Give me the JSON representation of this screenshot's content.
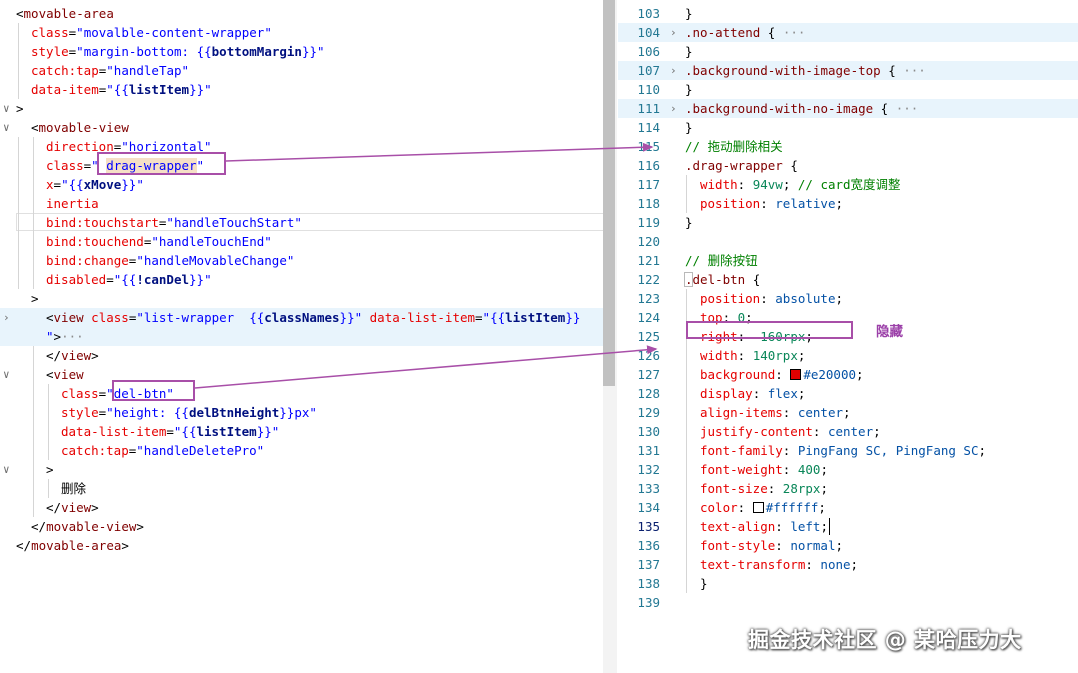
{
  "left_editor": {
    "lines": [
      [
        [
          "c-pun",
          "<"
        ],
        [
          "c-tag",
          "movable-area"
        ]
      ],
      [
        [
          "c-attr",
          "class"
        ],
        [
          "c-pun",
          "="
        ],
        [
          "c-str",
          "\"movalble-content-wrapper\""
        ]
      ],
      [
        [
          "c-attr",
          "style"
        ],
        [
          "c-pun",
          "="
        ],
        [
          "c-str",
          "\"margin-bottom: {{"
        ],
        [
          "c-var",
          "bottomMargin"
        ],
        [
          "c-str",
          "}}\""
        ]
      ],
      [
        [
          "c-attr",
          "catch:tap"
        ],
        [
          "c-pun",
          "="
        ],
        [
          "c-str",
          "\"handleTap\""
        ]
      ],
      [
        [
          "c-attr",
          "data-item"
        ],
        [
          "c-pun",
          "="
        ],
        [
          "c-str",
          "\"{{"
        ],
        [
          "c-var",
          "listItem"
        ],
        [
          "c-str",
          "}}\""
        ]
      ],
      [
        [
          "c-pun",
          ">"
        ]
      ],
      [
        [
          "c-pun",
          "<"
        ],
        [
          "c-tag",
          "movable-view"
        ]
      ],
      [
        [
          "c-attr",
          "direction"
        ],
        [
          "c-pun",
          "="
        ],
        [
          "c-str",
          "\"horizontal\""
        ]
      ],
      [
        [
          "c-attr",
          "class"
        ],
        [
          "c-pun",
          "="
        ],
        [
          "c-str",
          "\" "
        ],
        [
          "c-str word-hl",
          "drag-wrapper"
        ],
        [
          "c-str",
          "\""
        ]
      ],
      [
        [
          "c-attr",
          "x"
        ],
        [
          "c-pun",
          "="
        ],
        [
          "c-str",
          "\"{{"
        ],
        [
          "c-var",
          "xMove"
        ],
        [
          "c-str",
          "}}\""
        ]
      ],
      [
        [
          "c-attr",
          "inertia"
        ]
      ],
      [
        [
          "c-attr",
          "bind:touchstart"
        ],
        [
          "c-pun",
          "="
        ],
        [
          "c-str",
          "\"handleTouchStart\""
        ]
      ],
      [
        [
          "c-attr",
          "bind:touchend"
        ],
        [
          "c-pun",
          "="
        ],
        [
          "c-str",
          "\"handleTouchEnd\""
        ]
      ],
      [
        [
          "c-attr",
          "bind:change"
        ],
        [
          "c-pun",
          "="
        ],
        [
          "c-str",
          "\"handleMovableChange\""
        ]
      ],
      [
        [
          "c-attr",
          "disabled"
        ],
        [
          "c-pun",
          "="
        ],
        [
          "c-str",
          "\"{{"
        ],
        [
          "c-var",
          "!canDel"
        ],
        [
          "c-str",
          "}}\""
        ]
      ],
      [
        [
          "c-pun",
          ">"
        ]
      ],
      [
        [
          "c-pun",
          "<"
        ],
        [
          "c-tag",
          "view"
        ],
        [
          "c-txt",
          " "
        ],
        [
          "c-attr",
          "class"
        ],
        [
          "c-pun",
          "="
        ],
        [
          "c-str",
          "\"list-wrapper  {{"
        ],
        [
          "c-var",
          "classNames"
        ],
        [
          "c-str",
          "}}\""
        ],
        [
          "c-txt",
          " "
        ],
        [
          "c-attr",
          "data-list-item"
        ],
        [
          "c-pun",
          "="
        ],
        [
          "c-str",
          "\"{{"
        ],
        [
          "c-var",
          "listItem"
        ],
        [
          "c-str",
          "}}"
        ]
      ],
      [
        [
          "c-str",
          "\""
        ],
        [
          "c-pun",
          ">"
        ],
        [
          "c-dots",
          "···"
        ]
      ],
      [
        [
          "c-pun",
          "</"
        ],
        [
          "c-tag",
          "view"
        ],
        [
          "c-pun",
          ">"
        ]
      ],
      [
        [
          "c-pun",
          "<"
        ],
        [
          "c-tag",
          "view"
        ]
      ],
      [
        [
          "c-attr",
          "class"
        ],
        [
          "c-pun",
          "="
        ],
        [
          "c-str",
          "\"del-btn\""
        ]
      ],
      [
        [
          "c-attr",
          "style"
        ],
        [
          "c-pun",
          "="
        ],
        [
          "c-str",
          "\"height: {{"
        ],
        [
          "c-var",
          "delBtnHeight"
        ],
        [
          "c-str",
          "}}px\""
        ]
      ],
      [
        [
          "c-attr",
          "data-list-item"
        ],
        [
          "c-pun",
          "="
        ],
        [
          "c-str",
          "\"{{"
        ],
        [
          "c-var",
          "listItem"
        ],
        [
          "c-str",
          "}}\""
        ]
      ],
      [
        [
          "c-attr",
          "catch:tap"
        ],
        [
          "c-pun",
          "="
        ],
        [
          "c-str",
          "\"handleDeletePro\""
        ]
      ],
      [
        [
          "c-pun",
          ">"
        ]
      ],
      [
        [
          "c-txt",
          "删除"
        ]
      ],
      [
        [
          "c-pun",
          "</"
        ],
        [
          "c-tag",
          "view"
        ],
        [
          "c-pun",
          ">"
        ]
      ],
      [
        [
          "c-pun",
          "</"
        ],
        [
          "c-tag",
          "movable-view"
        ],
        [
          "c-pun",
          ">"
        ]
      ],
      [
        [
          "c-pun",
          "</"
        ],
        [
          "c-tag",
          "movable-area"
        ],
        [
          "c-pun",
          ">"
        ]
      ]
    ]
  },
  "right_editor": {
    "lines": [
      {
        "n": "103",
        "t": [
          [
            "c-pun",
            "}"
          ]
        ]
      },
      {
        "n": "104",
        "t": [
          [
            "c-sel",
            ".no-attend"
          ],
          [
            "c-pun",
            " { "
          ],
          [
            "c-dots",
            "···"
          ]
        ]
      },
      {
        "n": "106",
        "t": [
          [
            "c-pun",
            "}"
          ]
        ]
      },
      {
        "n": "107",
        "t": [
          [
            "c-sel",
            ".background-with-image-top"
          ],
          [
            "c-pun",
            " { "
          ],
          [
            "c-dots",
            "···"
          ]
        ]
      },
      {
        "n": "110",
        "t": [
          [
            "c-pun",
            "}"
          ]
        ]
      },
      {
        "n": "111",
        "t": [
          [
            "c-sel",
            ".background-with-no-image"
          ],
          [
            "c-pun",
            " { "
          ],
          [
            "c-dots",
            "···"
          ]
        ]
      },
      {
        "n": "114",
        "t": [
          [
            "c-pun",
            "}"
          ]
        ]
      },
      {
        "n": "115",
        "t": [
          [
            "c-com",
            "// 拖动删除相关"
          ]
        ]
      },
      {
        "n": "116",
        "t": [
          [
            "c-sel",
            ".drag-wrapper"
          ],
          [
            "c-pun",
            " {"
          ]
        ]
      },
      {
        "n": "117",
        "t": [
          [
            "c-prop",
            "width"
          ],
          [
            "c-pun",
            ": "
          ],
          [
            "c-num",
            "94vw"
          ],
          [
            "c-pun",
            "; "
          ],
          [
            "c-com",
            "// card宽度调整"
          ]
        ]
      },
      {
        "n": "118",
        "t": [
          [
            "c-prop",
            "position"
          ],
          [
            "c-pun",
            ": "
          ],
          [
            "c-val",
            "relative"
          ],
          [
            "c-pun",
            ";"
          ]
        ]
      },
      {
        "n": "119",
        "t": [
          [
            "c-pun",
            "}"
          ]
        ]
      },
      {
        "n": "120",
        "t": []
      },
      {
        "n": "121",
        "t": [
          [
            "c-com",
            "// 删除按钮"
          ]
        ]
      },
      {
        "n": "122",
        "t": [
          [
            "c-sel",
            ".del-btn"
          ],
          [
            "c-pun",
            " {"
          ]
        ]
      },
      {
        "n": "123",
        "t": [
          [
            "c-prop",
            "position"
          ],
          [
            "c-pun",
            ": "
          ],
          [
            "c-val",
            "absolute"
          ],
          [
            "c-pun",
            ";"
          ]
        ]
      },
      {
        "n": "124",
        "t": [
          [
            "c-prop",
            "top"
          ],
          [
            "c-pun",
            ": "
          ],
          [
            "c-num",
            "0"
          ],
          [
            "c-pun",
            ";"
          ]
        ]
      },
      {
        "n": "125",
        "t": [
          [
            "c-prop",
            "right"
          ],
          [
            "c-pun",
            ": "
          ],
          [
            "c-num",
            "-160rpx"
          ],
          [
            "c-pun",
            ";"
          ]
        ]
      },
      {
        "n": "126",
        "t": [
          [
            "c-prop",
            "width"
          ],
          [
            "c-pun",
            ": "
          ],
          [
            "c-num",
            "140rpx"
          ],
          [
            "c-pun",
            ";"
          ]
        ]
      },
      {
        "n": "127",
        "t": [
          [
            "c-prop",
            "background"
          ],
          [
            "c-pun",
            ": "
          ],
          [
            "swatch",
            "#e20000"
          ],
          [
            "c-val",
            "#e20000"
          ],
          [
            "c-pun",
            ";"
          ]
        ]
      },
      {
        "n": "128",
        "t": [
          [
            "c-prop",
            "display"
          ],
          [
            "c-pun",
            ": "
          ],
          [
            "c-val",
            "flex"
          ],
          [
            "c-pun",
            ";"
          ]
        ]
      },
      {
        "n": "129",
        "t": [
          [
            "c-prop",
            "align-items"
          ],
          [
            "c-pun",
            ": "
          ],
          [
            "c-val",
            "center"
          ],
          [
            "c-pun",
            ";"
          ]
        ]
      },
      {
        "n": "130",
        "t": [
          [
            "c-prop",
            "justify-content"
          ],
          [
            "c-pun",
            ": "
          ],
          [
            "c-val",
            "center"
          ],
          [
            "c-pun",
            ";"
          ]
        ]
      },
      {
        "n": "131",
        "t": [
          [
            "c-prop",
            "font-family"
          ],
          [
            "c-pun",
            ": "
          ],
          [
            "c-val",
            "PingFang SC, PingFang SC"
          ],
          [
            "c-pun",
            ";"
          ]
        ]
      },
      {
        "n": "132",
        "t": [
          [
            "c-prop",
            "font-weight"
          ],
          [
            "c-pun",
            ": "
          ],
          [
            "c-num",
            "400"
          ],
          [
            "c-pun",
            ";"
          ]
        ]
      },
      {
        "n": "133",
        "t": [
          [
            "c-prop",
            "font-size"
          ],
          [
            "c-pun",
            ": "
          ],
          [
            "c-num",
            "28rpx"
          ],
          [
            "c-pun",
            ";"
          ]
        ]
      },
      {
        "n": "134",
        "t": [
          [
            "c-prop",
            "color"
          ],
          [
            "c-pun",
            ": "
          ],
          [
            "swatch",
            "#ffffff"
          ],
          [
            "c-val",
            "#ffffff"
          ],
          [
            "c-pun",
            ";"
          ]
        ]
      },
      {
        "n": "135",
        "t": [
          [
            "c-prop",
            "text-align"
          ],
          [
            "c-pun",
            ": "
          ],
          [
            "c-val",
            "left"
          ],
          [
            "c-pun",
            ";"
          ]
        ]
      },
      {
        "n": "136",
        "t": [
          [
            "c-prop",
            "font-style"
          ],
          [
            "c-pun",
            ": "
          ],
          [
            "c-val",
            "normal"
          ],
          [
            "c-pun",
            ";"
          ]
        ]
      },
      {
        "n": "137",
        "t": [
          [
            "c-prop",
            "text-transform"
          ],
          [
            "c-pun",
            ": "
          ],
          [
            "c-val",
            "none"
          ],
          [
            "c-pun",
            ";"
          ]
        ]
      },
      {
        "n": "138",
        "t": [
          [
            "c-pun",
            "}"
          ]
        ]
      },
      {
        "n": "139",
        "t": []
      }
    ]
  },
  "annotation_label": "隐藏",
  "watermark": "掘金技术社区 @ 某哈压力大",
  "colors": {
    "annotation": "#a84fa8",
    "del_btn_background": "#e20000",
    "del_btn_color": "#ffffff"
  }
}
